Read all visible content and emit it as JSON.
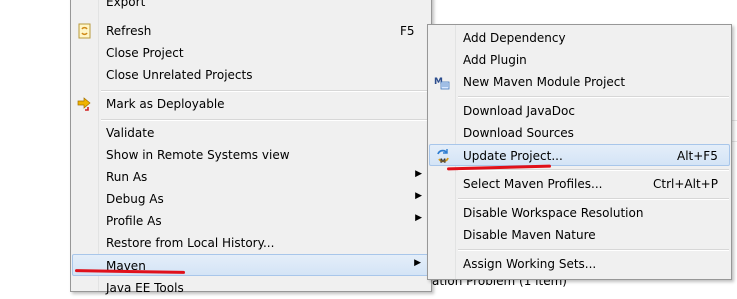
{
  "main_menu": {
    "items": [
      {
        "label": "Export"
      },
      {
        "label": "Refresh",
        "accel": "F5"
      },
      {
        "label": "Close Project"
      },
      {
        "label": "Close Unrelated Projects"
      },
      {
        "label": "Mark as Deployable"
      },
      {
        "label": "Validate"
      },
      {
        "label": "Show in Remote Systems view"
      },
      {
        "label": "Run As"
      },
      {
        "label": "Debug As"
      },
      {
        "label": "Profile As"
      },
      {
        "label": "Restore from Local History..."
      },
      {
        "label": "Maven"
      },
      {
        "label": "Java EE Tools"
      }
    ]
  },
  "maven_submenu": {
    "items": [
      {
        "label": "Add Dependency"
      },
      {
        "label": "Add Plugin"
      },
      {
        "label": "New Maven Module Project"
      },
      {
        "label": "Download JavaDoc"
      },
      {
        "label": "Download Sources"
      },
      {
        "label": "Update Project...",
        "accel": "Alt+F5"
      },
      {
        "label": "Select Maven Profiles...",
        "accel": "Ctrl+Alt+P"
      },
      {
        "label": "Disable Workspace Resolution"
      },
      {
        "label": "Disable Maven Nature"
      },
      {
        "label": "Assign Working Sets..."
      }
    ]
  },
  "background": {
    "partial_text": "ation Problem (1 item)"
  },
  "colors": {
    "highlight": "#d4e4f6",
    "annotation": "#e0101a"
  }
}
